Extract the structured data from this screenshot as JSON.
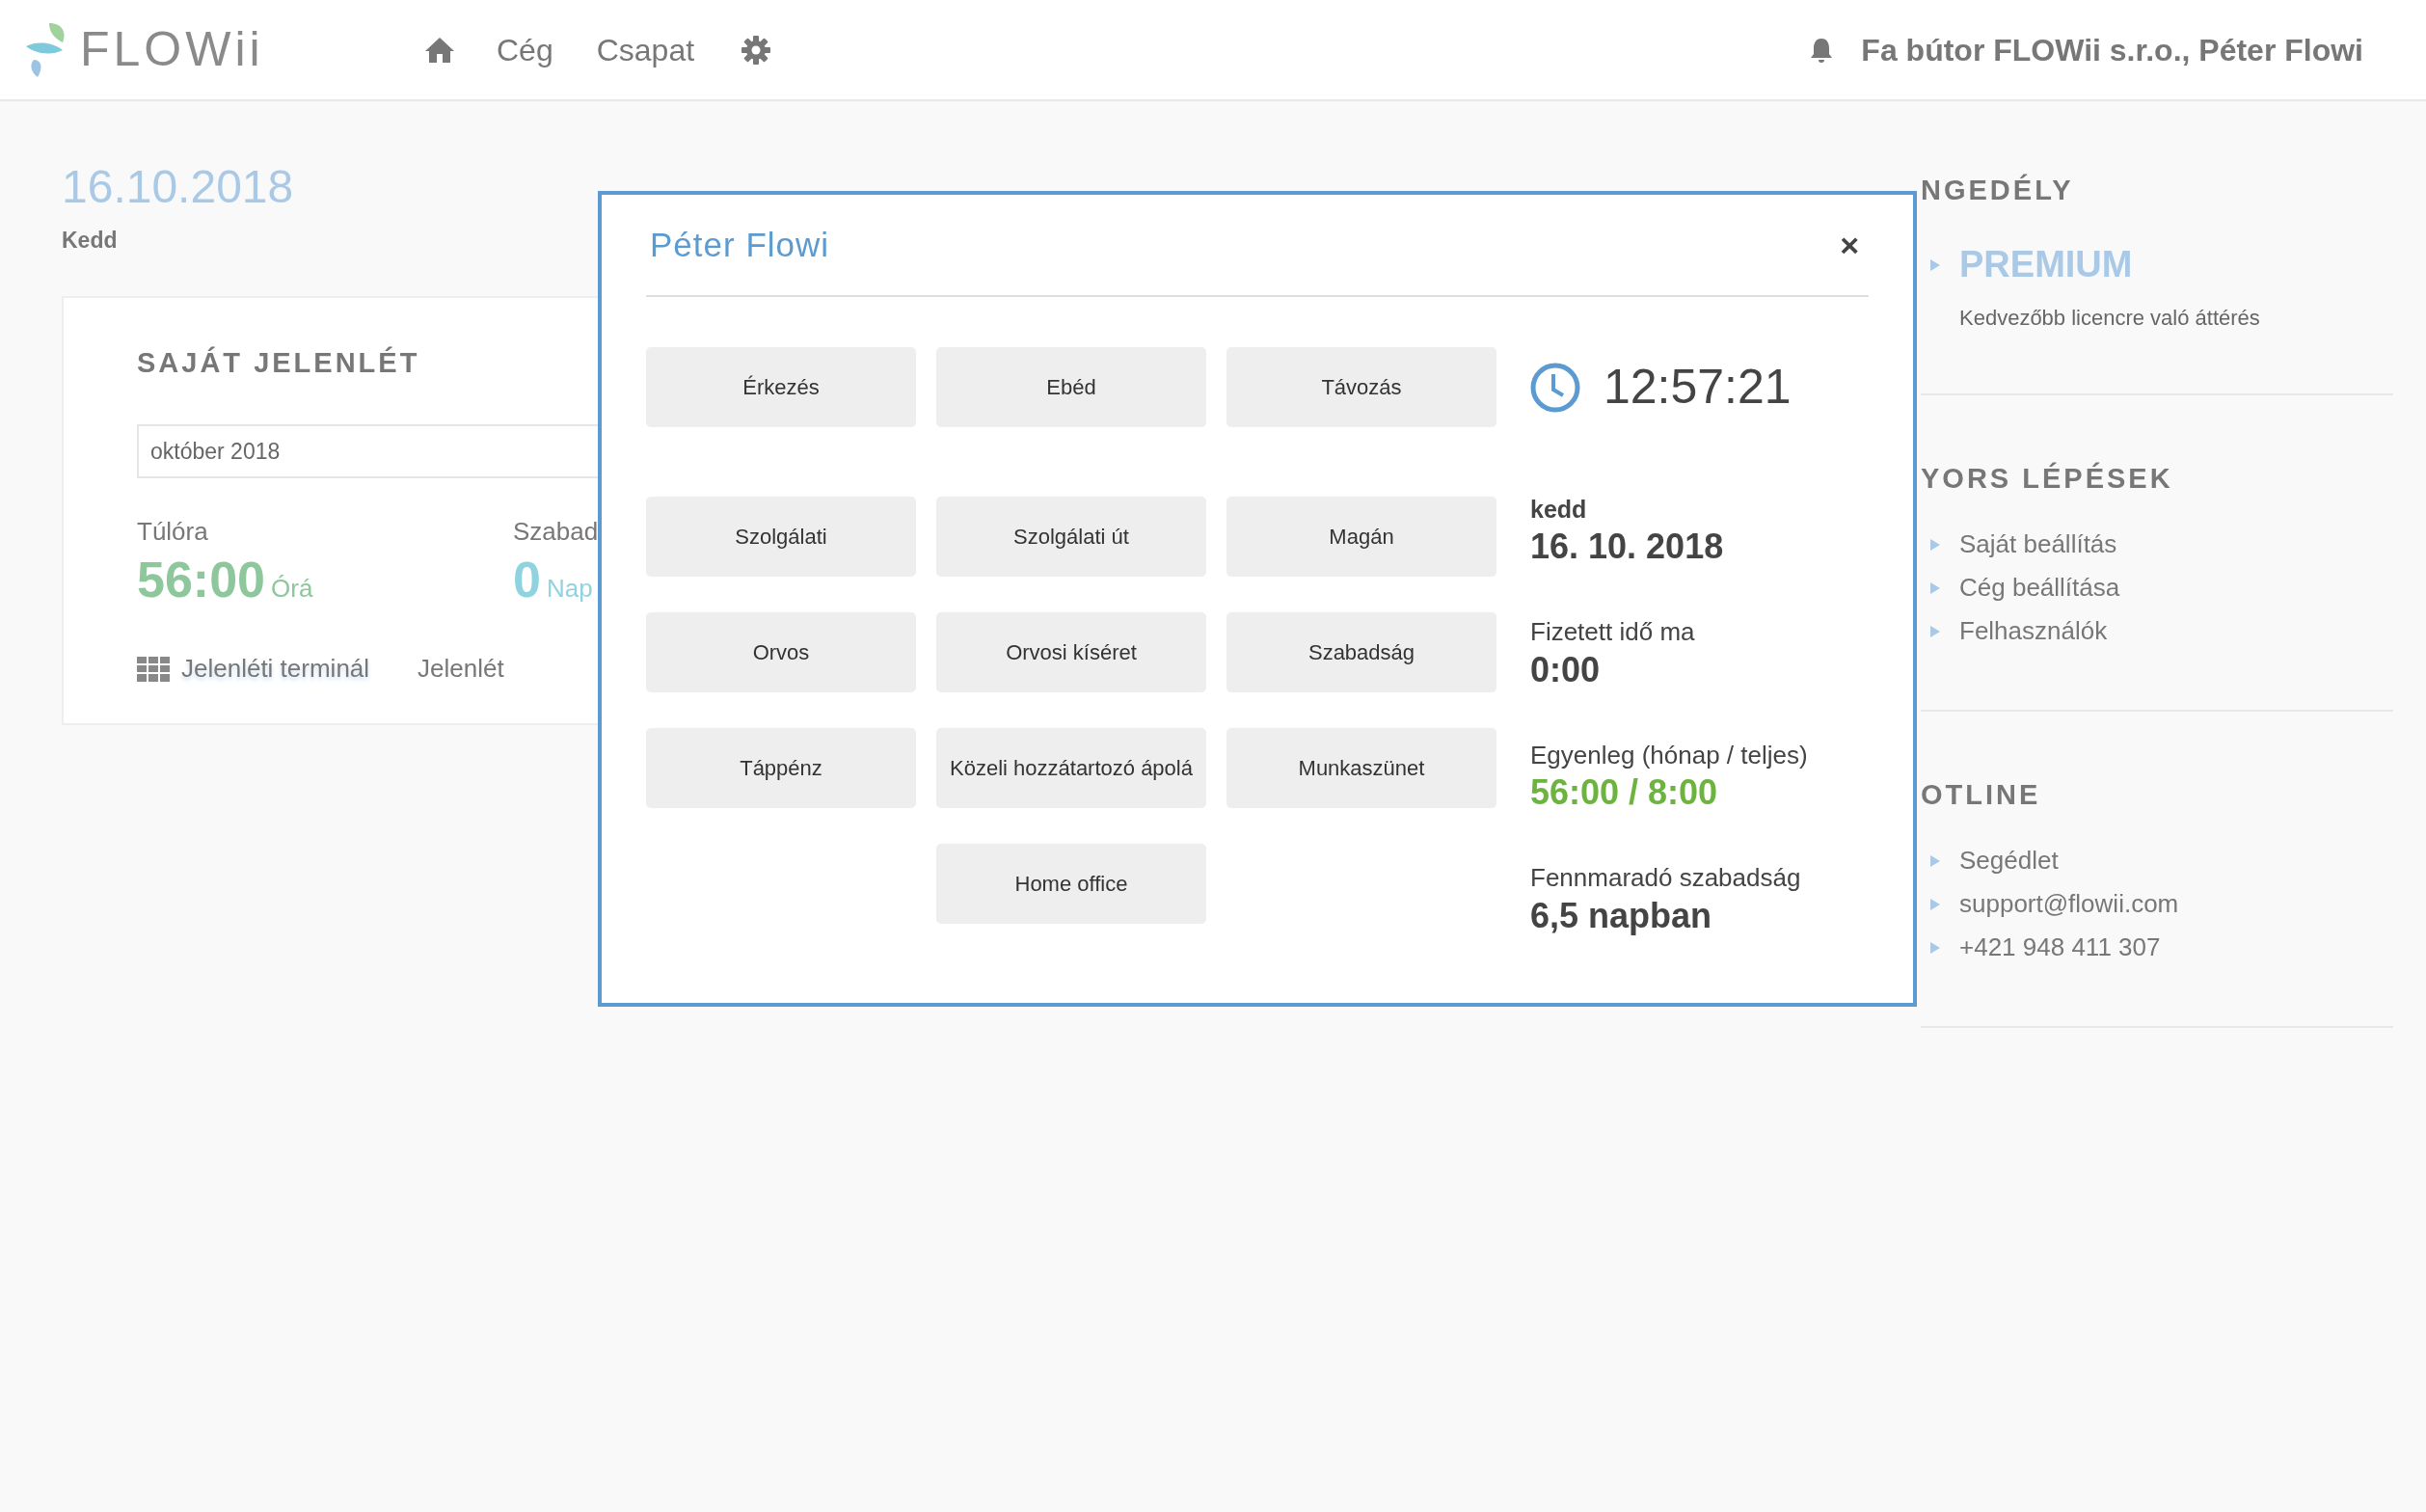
{
  "header": {
    "logo": "FLOWii",
    "nav": [
      "Cég",
      "Csapat"
    ],
    "account": "Fa bútor FLOWii s.r.o., Péter Flowi"
  },
  "today": {
    "date": "16.10.2018",
    "day": "Kedd"
  },
  "attendance": {
    "title": "SAJÁT JELENLÉT",
    "month": "október 2018",
    "stats": [
      {
        "label": "Túlóra",
        "value": "56:00",
        "unit": "Órá",
        "color": "#8dc79b"
      },
      {
        "label": "Szabad",
        "value": "0",
        "unit": "Nap",
        "color": "#8fd3df"
      }
    ],
    "links": [
      {
        "label": "Jelenléti terminál",
        "kind": "terminal"
      },
      {
        "label": "Jelenlét",
        "kind": "plain"
      }
    ]
  },
  "dialog": {
    "title": "Péter Flowi",
    "close": "×",
    "rows": [
      [
        "Érkezés",
        "Ebéd",
        "Távozás"
      ],
      [
        "Szolgálati",
        "Szolgálati út",
        "Magán"
      ],
      [
        "Orvos",
        "Orvosi kíséret",
        "Szabadság"
      ],
      [
        "Táppénz",
        "Közeli hozzátartozó ápolá",
        "Munkaszünet"
      ],
      [
        "",
        "Home office",
        ""
      ]
    ],
    "clock": "12:57:21",
    "day": "kedd",
    "date": "16. 10. 2018",
    "stats": [
      {
        "label": "Fizetett idő ma",
        "value": "0:00",
        "highlighted": false
      },
      {
        "label": "Egyenleg (hónap / teljes)",
        "value": "56:00 / 8:00",
        "highlighted": true
      },
      {
        "label": "Fennmaradó szabadság",
        "value": "6,5 napban",
        "highlighted": false
      }
    ]
  },
  "sidebar": [
    {
      "title": "NGEDÉLY",
      "items": [
        {
          "kind": "highlight",
          "label": "PREMIUM",
          "note": "Kedvezőbb licencre való áttérés"
        }
      ]
    },
    {
      "title": "YORS LÉPÉSEK",
      "items": [
        {
          "kind": "link",
          "label": "Saját beállítás"
        },
        {
          "kind": "link",
          "label": "Cég beállítása"
        },
        {
          "kind": "link",
          "label": "Felhasználók"
        }
      ]
    },
    {
      "title": "OTLINE",
      "items": [
        {
          "kind": "link",
          "label": "Segédlet"
        },
        {
          "kind": "link",
          "label": "support@flowii.com"
        },
        {
          "kind": "link",
          "label": "+421 948 411 307"
        }
      ]
    }
  ]
}
